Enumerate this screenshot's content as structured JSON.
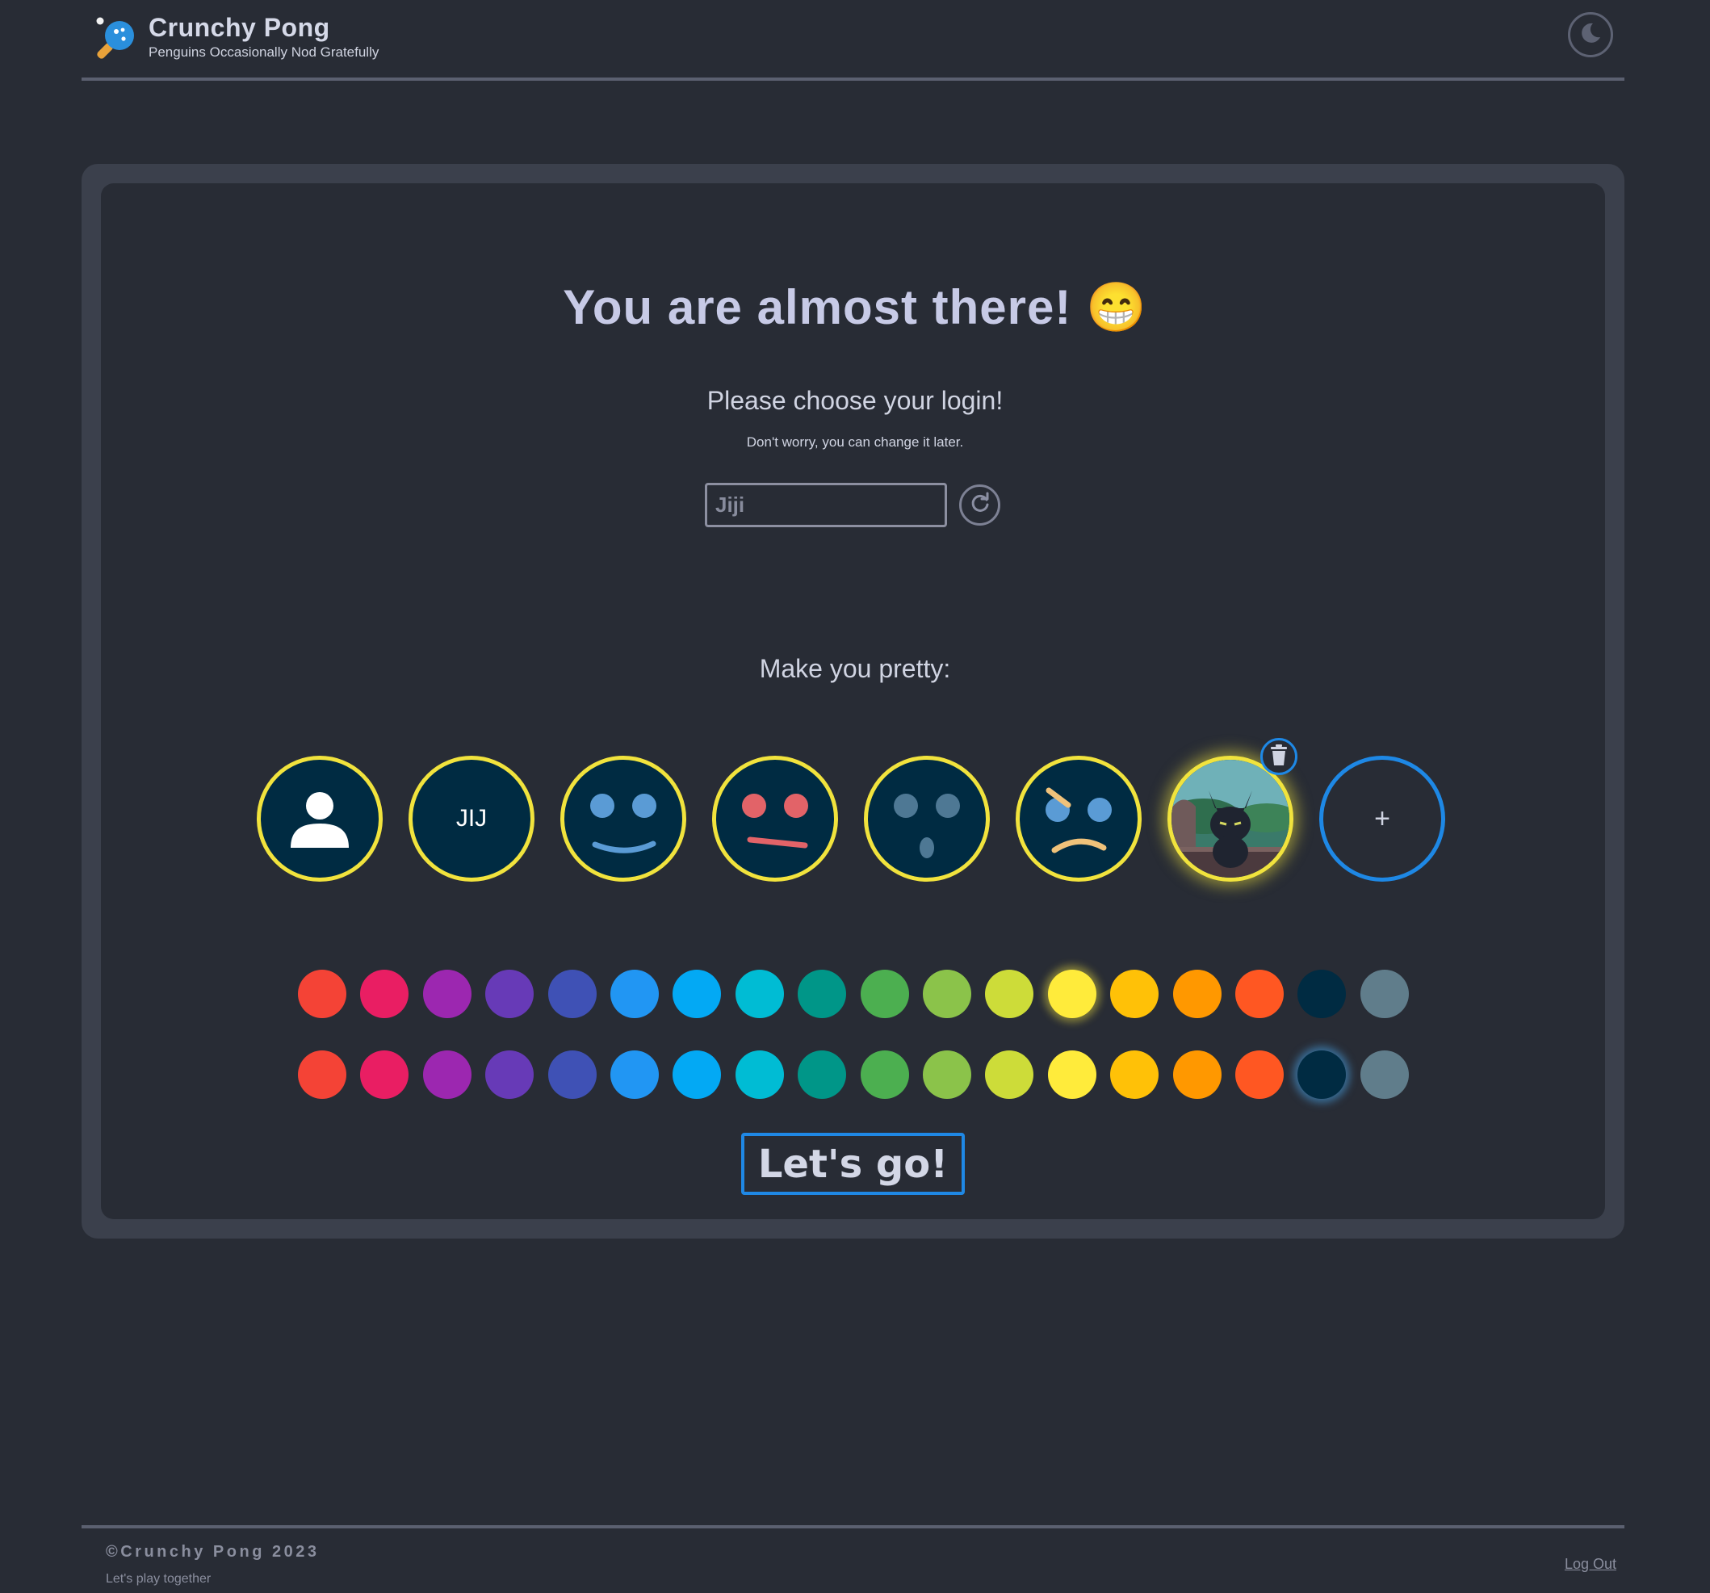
{
  "header": {
    "brand_title": "Crunchy Pong",
    "brand_subtitle": "Penguins Occasionally Nod Gratefully",
    "logo_icon": "ping-pong-paddle-icon",
    "theme_toggle_icon": "moon-icon"
  },
  "main": {
    "title": "You are almost there! 😁",
    "subtitle": "Please choose your login!",
    "hint": "Don't worry, you can change it later.",
    "login_placeholder": "Jiji",
    "login_value": "",
    "refresh_icon": "refresh-icon",
    "section_title": "Make you pretty:",
    "avatars": [
      {
        "kind": "default-user",
        "icon": "user-icon"
      },
      {
        "kind": "initials",
        "text": "JIJ"
      },
      {
        "kind": "smile",
        "icon": "smile-face-icon"
      },
      {
        "kind": "neutral",
        "icon": "neutral-face-icon"
      },
      {
        "kind": "surprised",
        "icon": "surprised-face-icon"
      },
      {
        "kind": "sad",
        "icon": "sad-face-icon"
      },
      {
        "kind": "photo",
        "icon": "cat-photo-icon",
        "selected": true
      },
      {
        "kind": "add",
        "text": "+"
      }
    ],
    "delete_icon": "trash-icon",
    "border_colors": [
      "#f44336",
      "#e91e63",
      "#9c27b0",
      "#673ab7",
      "#3f51b5",
      "#2196f3",
      "#03a9f4",
      "#00bcd4",
      "#009688",
      "#4caf50",
      "#8bc34a",
      "#cddc39",
      "#ffeb3b",
      "#ffc107",
      "#ff9800",
      "#ff5722",
      "#002b42",
      "#607d8b"
    ],
    "selected_border_color": "#ffeb3b",
    "background_colors": [
      "#f44336",
      "#e91e63",
      "#9c27b0",
      "#673ab7",
      "#3f51b5",
      "#2196f3",
      "#03a9f4",
      "#00bcd4",
      "#009688",
      "#4caf50",
      "#8bc34a",
      "#cddc39",
      "#ffeb3b",
      "#ffc107",
      "#ff9800",
      "#ff5722",
      "#002b42",
      "#607d8b"
    ],
    "selected_background_color": "#002b42",
    "submit_label": "Let's go!"
  },
  "footer": {
    "copyright": "©Crunchy Pong 2023",
    "tagline": "Let's play together",
    "logout_label": "Log Out"
  },
  "colors": {
    "page_bg": "#282c35",
    "card_border": "#3b404c",
    "accent_yellow": "#f1e33d",
    "accent_blue": "#1e88e5",
    "avatar_bg": "#002b42"
  }
}
